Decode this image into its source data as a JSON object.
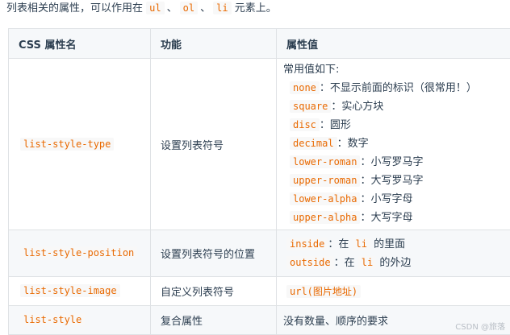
{
  "intro": {
    "prefix": "列表相关的属性，可以作用在",
    "code_ul": "ul",
    "sep1": "、",
    "code_ol": "ol",
    "sep2": "、",
    "code_li": "li",
    "suffix": "元素上。"
  },
  "table": {
    "headers": [
      "CSS 属性名",
      "功能",
      "属性值"
    ],
    "rows": [
      {
        "name": "list-style-type",
        "func": "设置列表符号",
        "values_head": "常用值如下:",
        "values": [
          {
            "code": "none",
            "desc": "：不显示前面的标识（很常用！）"
          },
          {
            "code": "square",
            "desc": "：实心方块"
          },
          {
            "code": "disc",
            "desc": "：圆形"
          },
          {
            "code": "decimal",
            "desc": "：数字"
          },
          {
            "code": "lower-roman",
            "desc": "：小写罗马字"
          },
          {
            "code": "upper-roman",
            "desc": "：大写罗马字"
          },
          {
            "code": "lower-alpha",
            "desc": "：小写字母"
          },
          {
            "code": "upper-alpha",
            "desc": "：大写字母"
          }
        ]
      },
      {
        "name": "list-style-position",
        "func": "设置列表符号的位置",
        "values": [
          {
            "code": "inside",
            "mid": "：在",
            "code2": "li",
            "desc": "的里面"
          },
          {
            "code": "outside",
            "mid": "：在",
            "code2": "li",
            "desc": "的外边"
          }
        ]
      },
      {
        "name": "list-style-image",
        "func": "自定义列表符号",
        "value_code": "url(图片地址)"
      },
      {
        "name": "list-style",
        "func": "复合属性",
        "value_text": "没有数量、顺序的要求"
      }
    ]
  },
  "watermark": "CSDN @旅落"
}
